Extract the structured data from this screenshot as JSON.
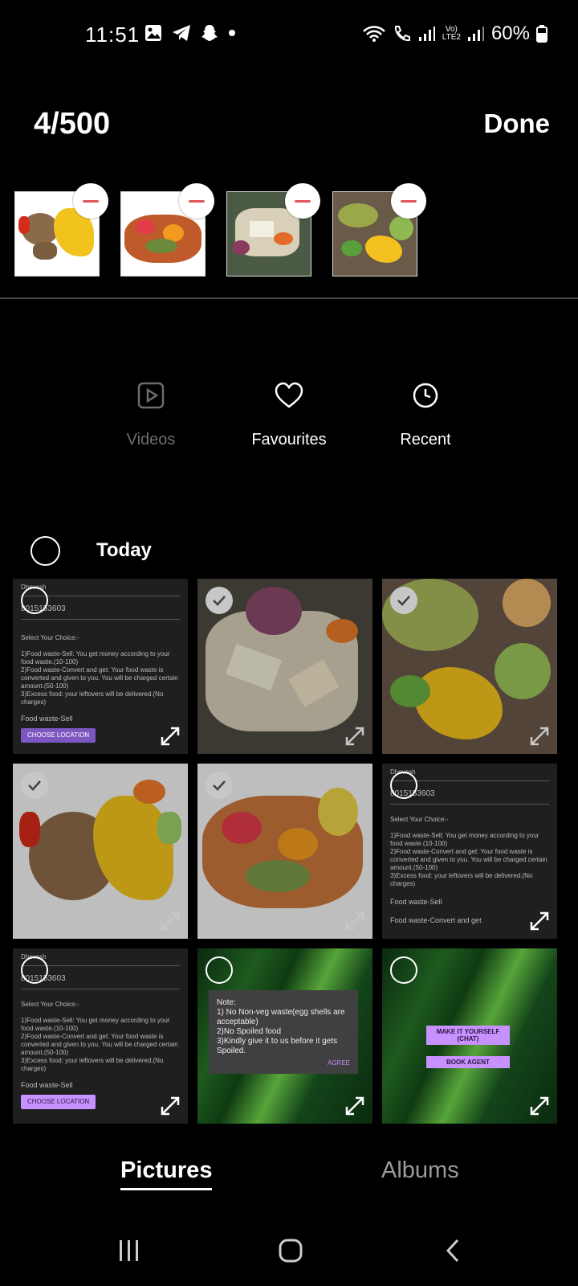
{
  "status": {
    "time": "11:51",
    "left_icons": [
      "gallery-icon",
      "telegram-icon",
      "snapchat-icon",
      "dot-icon"
    ],
    "right_icons": [
      "wifi-icon",
      "call-icon",
      "signal-icon",
      "volte-icon",
      "signal-icon",
      "battery-icon"
    ],
    "volte_label": "Vo)\nLTE2",
    "battery": "60%"
  },
  "topbar": {
    "count": "4/500",
    "done_label": "Done"
  },
  "selected": [
    {
      "name": "food-waste-banana"
    },
    {
      "name": "food-waste-mixed"
    },
    {
      "name": "food-waste-peels"
    },
    {
      "name": "food-waste-peppers"
    }
  ],
  "shortcuts": [
    {
      "label": "Videos",
      "icon": "video-icon",
      "enabled": false
    },
    {
      "label": "Favourites",
      "icon": "heart-icon",
      "enabled": true
    },
    {
      "label": "Recent",
      "icon": "clock-icon",
      "enabled": true
    }
  ],
  "section": {
    "title": "Today"
  },
  "screenshot_text": {
    "name": "Dhevesh",
    "phone": "8015153603",
    "select": "Select Your Choice:-",
    "opt1": "1)Food waste-Sell: You get money according to your food waste.(10-100)",
    "opt2": "2)Food waste-Convert and get: Your food waste is converted and given to you. You will be charged certain amount.(50-100)",
    "opt3": "3)Excess food: your leftovers will be delivered.(No charges)",
    "dropdown": "Food waste-Sell",
    "dropdown2": "Food waste-Convert and get",
    "choose_location": "CHOOSE LOCATION"
  },
  "note_dialog": {
    "title": "Note:",
    "l1": "1) No Non-veg waste(egg shells are acceptable)",
    "l2": "2)No Spoiled food",
    "l3": "3)Kindly give it to us before it gets Spoiled.",
    "agree": "AGREE"
  },
  "chat_screen": {
    "make": "MAKE IT YOURSELF (CHAT)",
    "book": "BOOK AGENT"
  },
  "tabs": {
    "pictures": "Pictures",
    "albums": "Albums"
  },
  "colors": {
    "accent_remove": "#e0555a",
    "button_purple": "#7d57c1"
  }
}
